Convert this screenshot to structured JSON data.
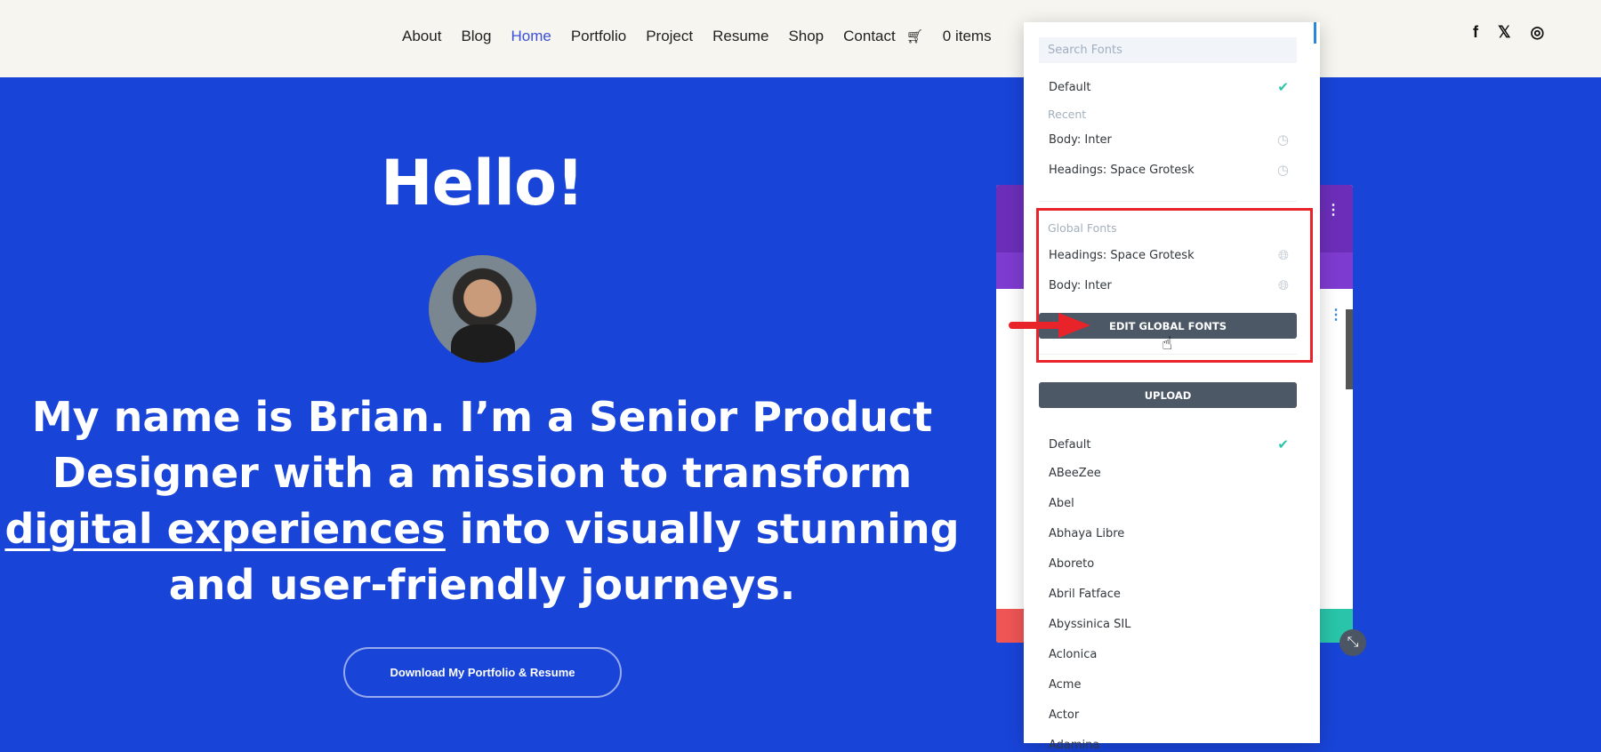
{
  "nav": {
    "items": [
      "About",
      "Blog",
      "Home",
      "Portfolio",
      "Project",
      "Resume",
      "Shop",
      "Contact"
    ],
    "active": "Home",
    "cart": "0 items",
    "cart_icon": "cart-icon",
    "search_icon": "search-icon"
  },
  "social": {
    "facebook": "f",
    "x": "𝕏",
    "instagram": "◎"
  },
  "hero": {
    "title": "Hello!",
    "line1": "My name is Brian. I’m a Senior Product",
    "line2": "Designer with a mission to transform",
    "line3_link": "digital experiences",
    "line3_rest": " into visually stunning",
    "line4": "and user-friendly journeys.",
    "cta": "Download My Portfolio & Resume"
  },
  "font_panel": {
    "search_placeholder": "Search Fonts",
    "default": "Default",
    "recent_label": "Recent",
    "recent": [
      "Body: Inter",
      "Headings: Space Grotesk"
    ],
    "global_label": "Global Fonts",
    "global": [
      "Headings: Space Grotesk",
      "Body: Inter"
    ],
    "edit_button": "EDIT GLOBAL FONTS",
    "upload_button": "UPLOAD",
    "fonts": [
      "Default",
      "ABeeZee",
      "Abel",
      "Abhaya Libre",
      "Aboreto",
      "Abril Fatface",
      "Abyssinica SIL",
      "Aclonica",
      "Acme",
      "Actor",
      "Adamina"
    ],
    "selected": "Default"
  },
  "colors": {
    "hero_bg": "#1844d8",
    "header_bg": "#f6f5ef",
    "accent_nav": "#3b4fd8",
    "button": "#4c5866",
    "highlight": "#e8242a",
    "check": "#29c4a9"
  }
}
